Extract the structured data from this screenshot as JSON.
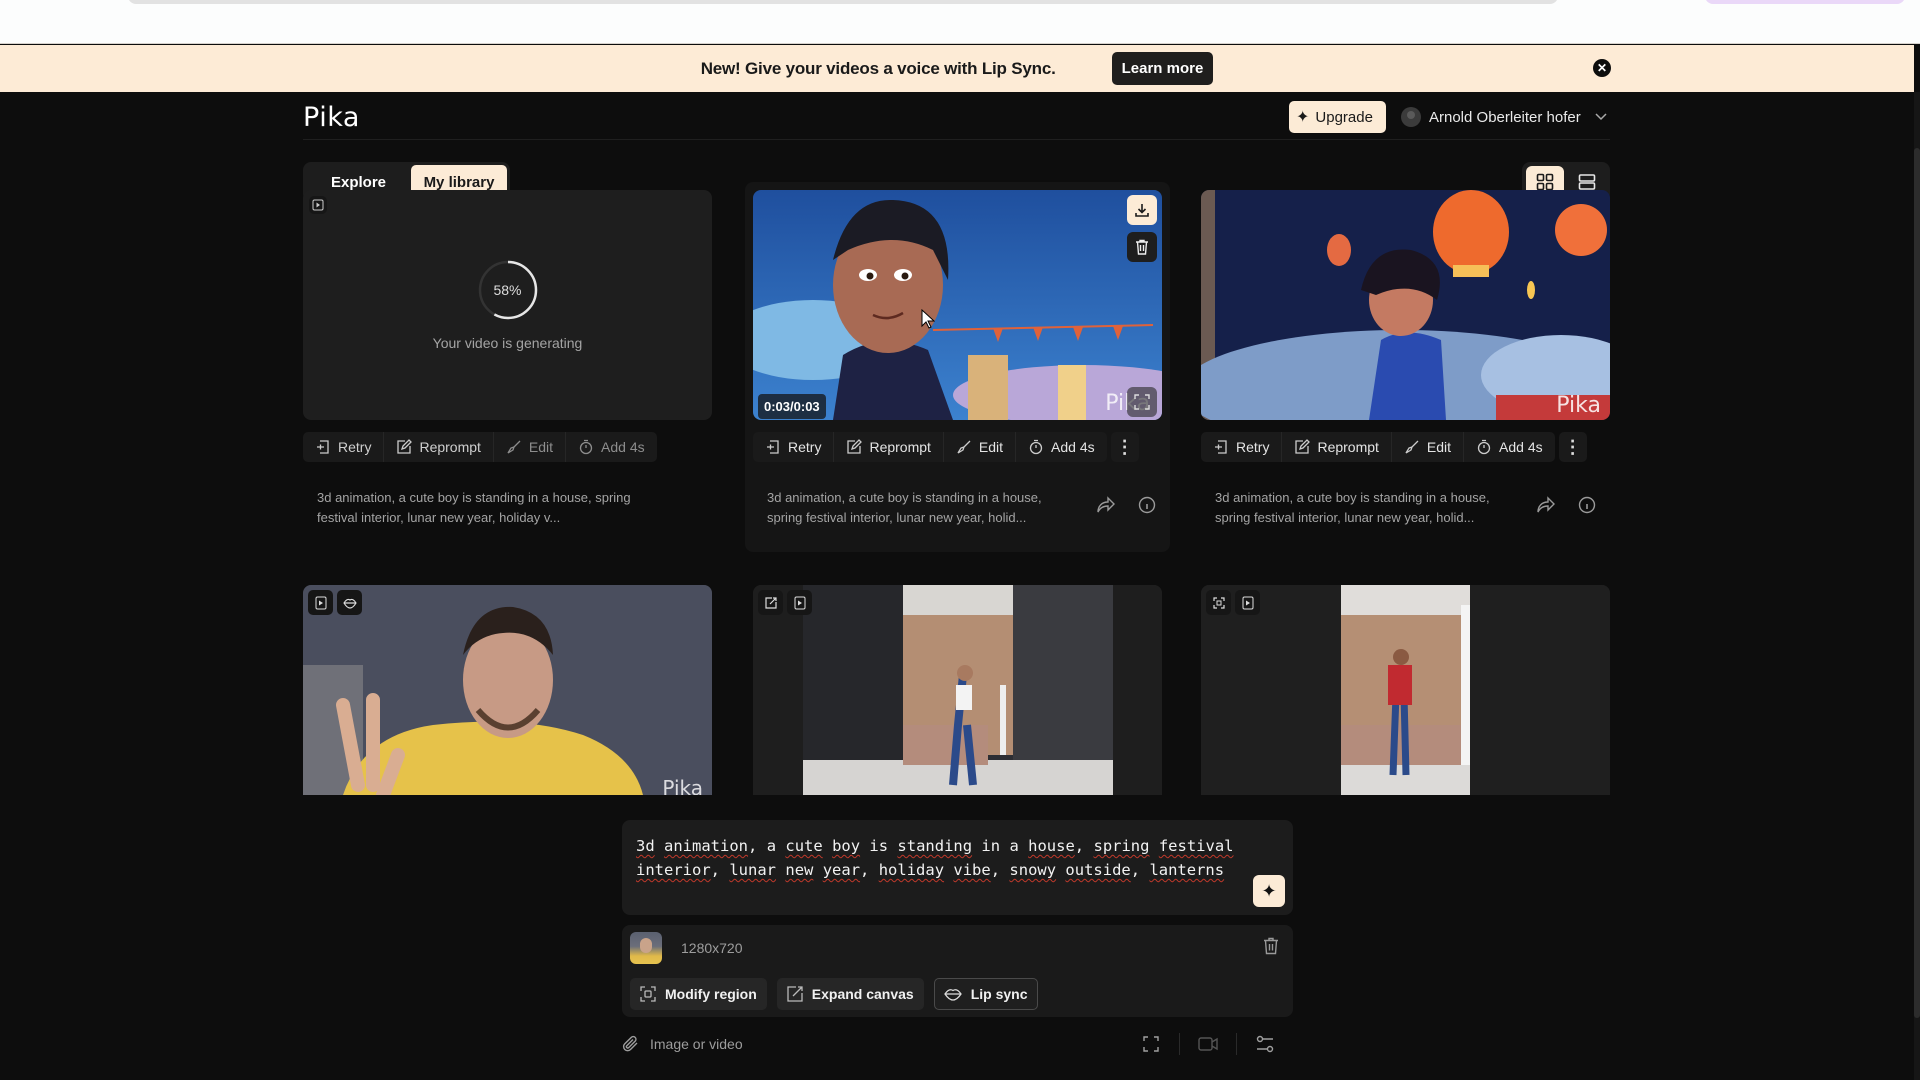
{
  "banner": {
    "message": "New! Give your videos a voice with Lip Sync.",
    "learn_more_label": "Learn more",
    "close_icon": "close-icon"
  },
  "header": {
    "logo": "Pika",
    "upgrade_label": "Upgrade",
    "user_name": "Arnold Oberleiter hofer"
  },
  "tabs": [
    {
      "label": "Explore",
      "active": false
    },
    {
      "label": "My library",
      "active": true
    }
  ],
  "view_toggle": {
    "active": "grid",
    "options": [
      "grid",
      "list"
    ]
  },
  "actions": {
    "retry": "Retry",
    "reprompt": "Reprompt",
    "edit": "Edit",
    "add4s": "Add 4s"
  },
  "cards": [
    {
      "status": "generating",
      "progress_percent": 58,
      "progress_label": "58%",
      "status_text": "Your video is generating",
      "description": "3d animation, a cute boy is standing in a house, spring festival interior, lunar new year, holiday v..."
    },
    {
      "status": "done",
      "timecode": "0:03/0:03",
      "watermark": "Pika",
      "description": "3d animation, a cute boy is standing in a house, spring festival interior, lunar new year, holid..."
    },
    {
      "status": "done",
      "watermark": "Pika",
      "description": "3d animation, a cute boy is standing in a house, spring festival interior, lunar new year, holid..."
    },
    {
      "status": "done",
      "watermark": "Pika",
      "badges": [
        "video-icon",
        "lips-icon"
      ]
    },
    {
      "status": "done",
      "badges": [
        "expand-icon",
        "video-icon"
      ]
    },
    {
      "status": "done",
      "badges": [
        "region-icon",
        "video-icon"
      ]
    }
  ],
  "prompt": {
    "text_words": [
      "3d",
      "animation,",
      "a",
      "cute",
      "boy",
      "is",
      "standing",
      "in",
      "a",
      "house,",
      "spring",
      "festival",
      "interior,",
      "lunar",
      "new",
      "year,",
      "holiday",
      "vibe,",
      "snowy",
      "outside,",
      "lanterns"
    ]
  },
  "attachment": {
    "resolution": "1280x720",
    "tools": [
      {
        "label": "Modify region",
        "icon": "region-icon"
      },
      {
        "label": "Expand canvas",
        "icon": "expand-icon"
      },
      {
        "label": "Lip sync",
        "icon": "lips-icon"
      }
    ]
  },
  "bottombar": {
    "attach_label": "Image or video"
  },
  "colors": {
    "accent_cream": "#fcebd6",
    "background": "#0d0d0d",
    "card": "#1e1e1e"
  }
}
